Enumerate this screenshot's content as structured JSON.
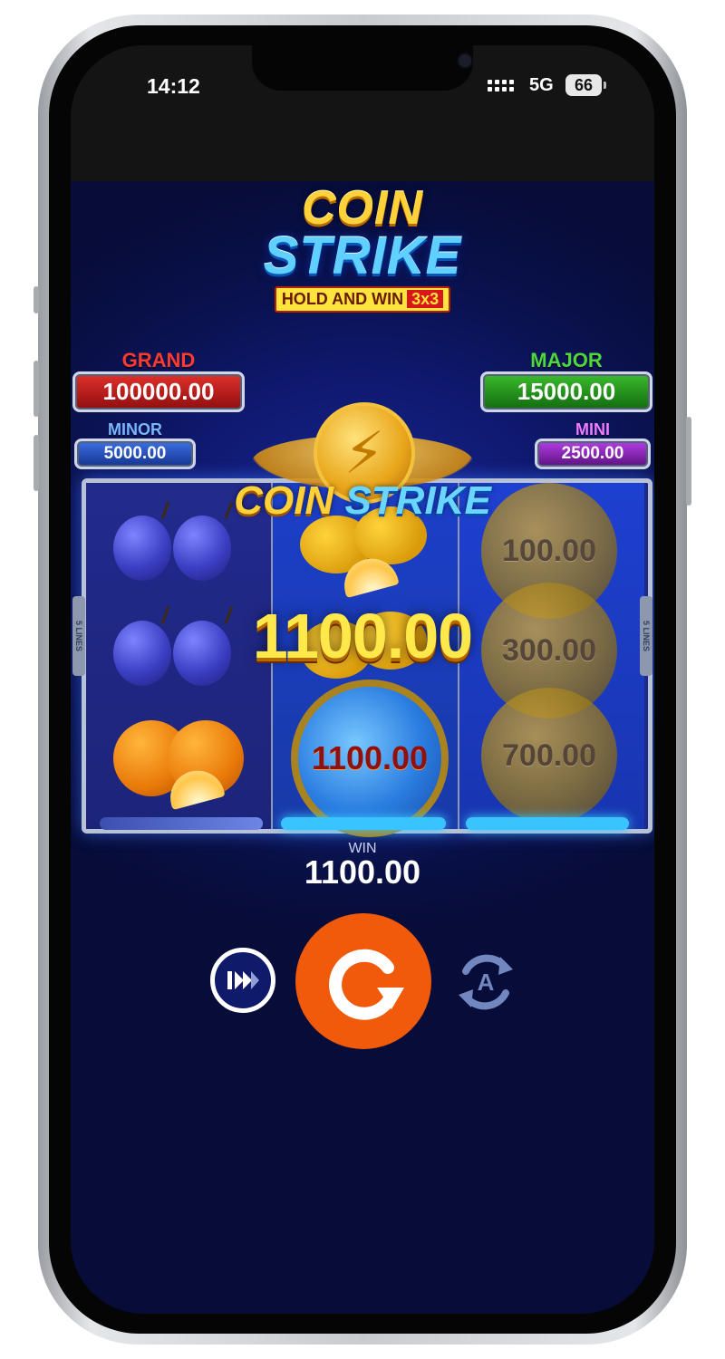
{
  "status_bar": {
    "time": "14:12",
    "network": "5G",
    "battery": "66"
  },
  "logo": {
    "line1": "COIN",
    "line2": "STRIKE",
    "subtitle": "HOLD AND WIN",
    "subtitle_badge": "3x3"
  },
  "jackpots": {
    "grand": {
      "label": "GRAND",
      "value": "100000.00"
    },
    "major": {
      "label": "MAJOR",
      "value": "15000.00"
    },
    "minor": {
      "label": "MINOR",
      "value": "5000.00"
    },
    "mini": {
      "label": "MINI",
      "value": "2500.00"
    }
  },
  "reel_logo": {
    "part1": "COIN",
    "part2": "STRIKE"
  },
  "paylines": "5 LINES",
  "reels": [
    {
      "symbols": [
        "plum",
        "plum",
        "orange"
      ]
    },
    {
      "symbols": [
        "lemon",
        "lemon",
        "blue-coin"
      ]
    },
    {
      "symbols": [
        "coin",
        "coin",
        "coin"
      ]
    }
  ],
  "coin_values": {
    "reel2_bottom": "1100.00",
    "reel3_top": "100.00",
    "reel3_mid": "300.00",
    "reel3_bottom": "700.00"
  },
  "big_win": "1100.00",
  "win": {
    "label": "WIN",
    "value": "1100.00"
  },
  "controls": {
    "turbo_icon": "fast-forward-icon",
    "spin_icon": "spin-icon",
    "autoplay_icon": "autoplay-icon",
    "autoplay_letter": "A"
  },
  "colors": {
    "spin_button": "#f05a0a",
    "grand": "#d8171b",
    "major": "#2aa31e",
    "minor": "#2d5fd6",
    "mini": "#9a2fd0"
  }
}
